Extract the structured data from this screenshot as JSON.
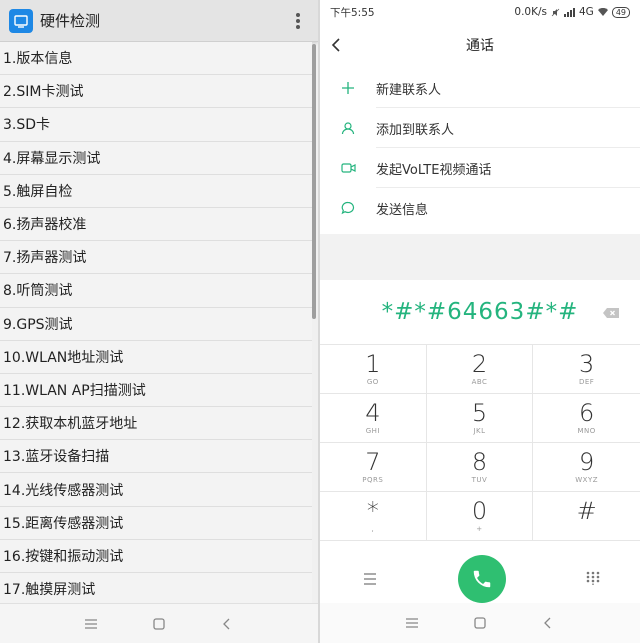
{
  "left": {
    "app_title": "硬件检测",
    "tests": [
      "1.版本信息",
      "2.SIM卡测试",
      "3.SD卡",
      "4.屏幕显示测试",
      "5.触屏自检",
      "6.扬声器校准",
      "7.扬声器测试",
      "8.听筒测试",
      "9.GPS测试",
      "10.WLAN地址测试",
      "11.WLAN AP扫描测试",
      "12.获取本机蓝牙地址",
      "13.蓝牙设备扫描",
      "14.光线传感器测试",
      "15.距离传感器测试",
      "16.按键和振动测试",
      "17.触摸屏测试"
    ]
  },
  "right": {
    "status": {
      "time": "下午5:55",
      "speed": "0.0K/s",
      "network": "4G",
      "battery": "49"
    },
    "title": "通话",
    "actions": [
      {
        "label": "新建联系人",
        "icon": "plus-icon"
      },
      {
        "label": "添加到联系人",
        "icon": "person-icon"
      },
      {
        "label": "发起VoLTE视频通话",
        "icon": "video-icon"
      },
      {
        "label": "发送信息",
        "icon": "message-icon"
      }
    ],
    "dialed_number": "*#*#64663#*#",
    "keypad": [
      {
        "digit": "1",
        "letters": "GO"
      },
      {
        "digit": "2",
        "letters": "ABC"
      },
      {
        "digit": "3",
        "letters": "DEF"
      },
      {
        "digit": "4",
        "letters": "GHI"
      },
      {
        "digit": "5",
        "letters": "JKL"
      },
      {
        "digit": "6",
        "letters": "MNO"
      },
      {
        "digit": "7",
        "letters": "PQRS"
      },
      {
        "digit": "8",
        "letters": "TUV"
      },
      {
        "digit": "9",
        "letters": "WXYZ"
      },
      {
        "digit": "*",
        "letters": ","
      },
      {
        "digit": "0",
        "letters": "+"
      },
      {
        "digit": "#",
        "letters": ""
      }
    ]
  },
  "colors": {
    "accent_green": "#24b47e",
    "call_button": "#2fbf71",
    "app_icon_blue": "#1e88e5"
  }
}
